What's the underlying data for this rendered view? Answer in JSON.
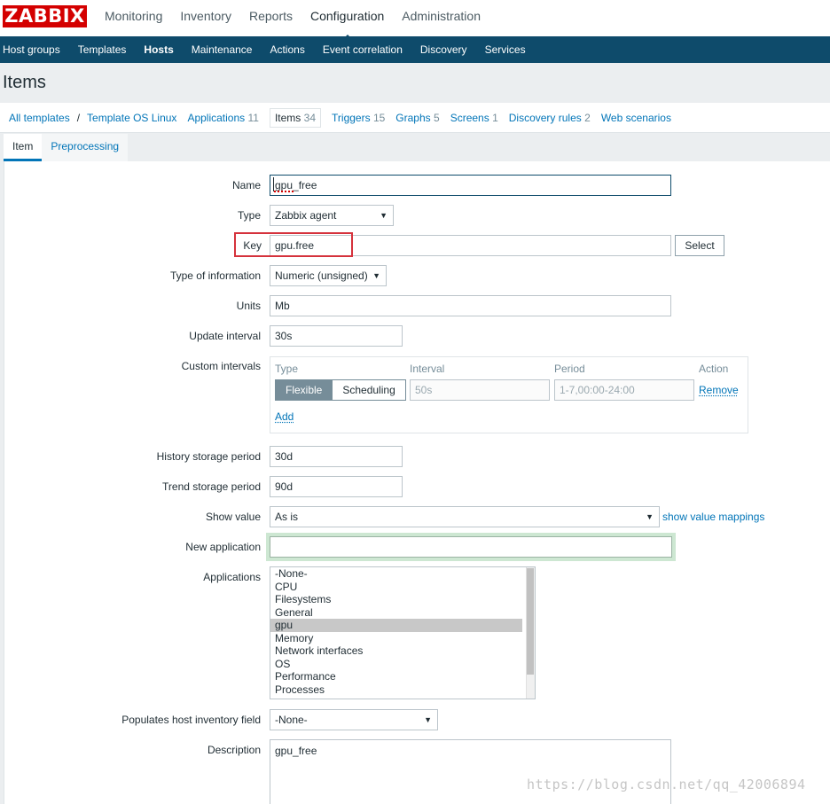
{
  "app": {
    "logo": "ZABBIX"
  },
  "topmenu": [
    "Monitoring",
    "Inventory",
    "Reports",
    "Configuration",
    "Administration"
  ],
  "submenu": [
    "Host groups",
    "Templates",
    "Hosts",
    "Maintenance",
    "Actions",
    "Event correlation",
    "Discovery",
    "Services"
  ],
  "page_title": "Items",
  "breadcrumb": {
    "all_templates": "All templates",
    "sep": "/",
    "template": "Template OS Linux"
  },
  "host_tabs": [
    {
      "label": "Applications",
      "count": "11"
    },
    {
      "label": "Items",
      "count": "34"
    },
    {
      "label": "Triggers",
      "count": "15"
    },
    {
      "label": "Graphs",
      "count": "5"
    },
    {
      "label": "Screens",
      "count": "1"
    },
    {
      "label": "Discovery rules",
      "count": "2"
    },
    {
      "label": "Web scenarios",
      "count": ""
    }
  ],
  "form_tabs": [
    "Item",
    "Preprocessing"
  ],
  "form": {
    "name_label": "Name",
    "name_value": "gpu_free",
    "type_label": "Type",
    "type_value": "Zabbix agent",
    "key_label": "Key",
    "key_value": "gpu.free",
    "select_button": "Select",
    "info_label": "Type of information",
    "info_value": "Numeric (unsigned)",
    "units_label": "Units",
    "units_value": "Mb",
    "interval_label": "Update interval",
    "interval_value": "30s",
    "custom_label": "Custom intervals",
    "custom_headers": {
      "type": "Type",
      "interval": "Interval",
      "period": "Period",
      "action": "Action"
    },
    "custom_row": {
      "flexible": "Flexible",
      "scheduling": "Scheduling",
      "interval_ph": "50s",
      "period_ph": "1-7,00:00-24:00",
      "remove": "Remove"
    },
    "custom_add": "Add",
    "history_label": "History storage period",
    "history_value": "30d",
    "trend_label": "Trend storage period",
    "trend_value": "90d",
    "showvalue_label": "Show value",
    "showvalue_value": "As is",
    "showvalue_link": "show value mappings",
    "newapp_label": "New application",
    "newapp_value": "",
    "apps_label": "Applications",
    "apps": [
      "-None-",
      "CPU",
      "Filesystems",
      "General",
      "gpu",
      "Memory",
      "Network interfaces",
      "OS",
      "Performance",
      "Processes"
    ],
    "apps_selected": "gpu",
    "inventory_label": "Populates host inventory field",
    "inventory_value": "-None-",
    "desc_label": "Description",
    "desc_value": "gpu_free"
  },
  "watermark": "https://blog.csdn.net/qq_42006894",
  "colors": {
    "brand": "#d40000",
    "nav": "#0e4b6b",
    "link": "#0275b8",
    "highlight": "#d5323c"
  }
}
